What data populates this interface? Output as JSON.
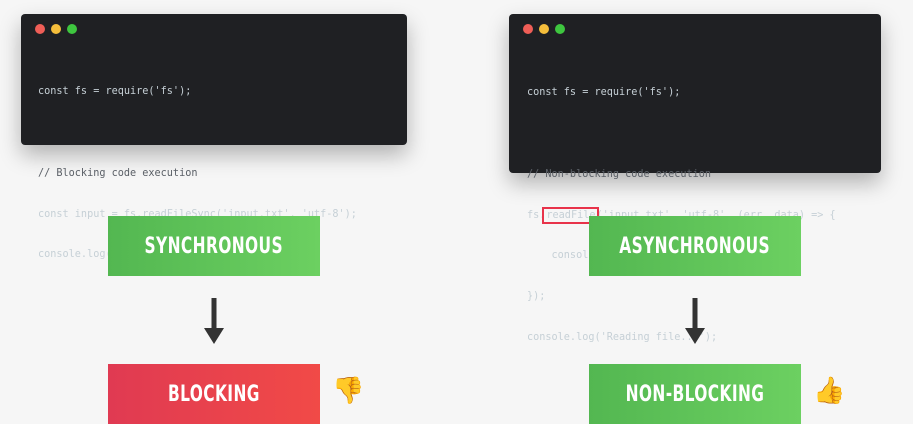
{
  "colors": {
    "window_bg": "#1f2023",
    "dot_red": "#ef5e57",
    "dot_yellow": "#f5be3b",
    "dot_green": "#3ec63f",
    "green_box": "#5cc455",
    "red_box": "#e8404d",
    "highlight_border": "#e8334a",
    "arrow": "#333333"
  },
  "left_code": {
    "l1": "const fs = require('fs');",
    "l2": "// Blocking code execution",
    "l3": "const input = fs.readFileSync('input.txt', 'utf-8');",
    "l4": "console.log(input);"
  },
  "right_code": {
    "l1": "const fs = require('fs');",
    "l2": "// Non-blocking code execution",
    "l3_a": "fs.",
    "l3_b": "readFile",
    "l3_c": "('input.txt', 'utf-8', (err, data) => {",
    "l4": "    console.log(data);",
    "l5": "});",
    "l6": "console.log('Reading file...');"
  },
  "left_column": {
    "top_label": "SYNCHRONOUS",
    "bottom_label": "BLOCKING",
    "emoji": "👎"
  },
  "right_column": {
    "top_label": "ASYNCHRONOUS",
    "bottom_label": "NON-BLOCKING",
    "emoji": "👍"
  },
  "icons": {
    "arrow": "down-arrow-icon",
    "thumbs_down": "thumbs-down-icon",
    "thumbs_up": "thumbs-up-icon"
  }
}
